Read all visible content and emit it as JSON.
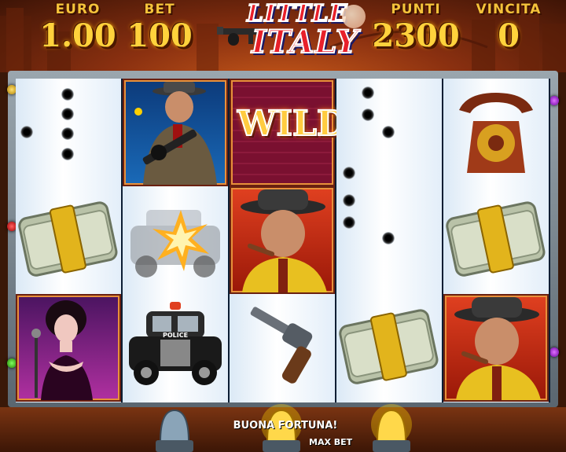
{
  "header": {
    "euro_label": "EURO",
    "euro_value": "1.00",
    "bet_label": "BET",
    "bet_value": "100",
    "logo_line1": "LITTLE",
    "logo_line2": "ITALY",
    "punti_label": "PUNTI",
    "punti_value": "2300",
    "vincita_label": "VINCITA",
    "vincita_value": "0"
  },
  "reels": [
    [
      "bullet-holes",
      "money-stack",
      "singer-woman"
    ],
    [
      "gangster-tommy-gun",
      "police-car-explosion",
      "police-car"
    ],
    [
      "wild",
      "mob-boss-cigar",
      "revolver"
    ],
    [
      "bullet-holes",
      "bullet-holes",
      "money-stack"
    ],
    [
      "rotary-telephone",
      "money-stack",
      "mob-boss-cigar"
    ]
  ],
  "wild_text": "WILD",
  "police_text": "POLICE",
  "footer": {
    "message": "BUONA FORTUNA!",
    "max_bet_label": "MAX BET"
  },
  "colors": {
    "gold": "#ffd23c",
    "logo_red": "#e8202a",
    "frame_dark": "#0b1d33"
  }
}
